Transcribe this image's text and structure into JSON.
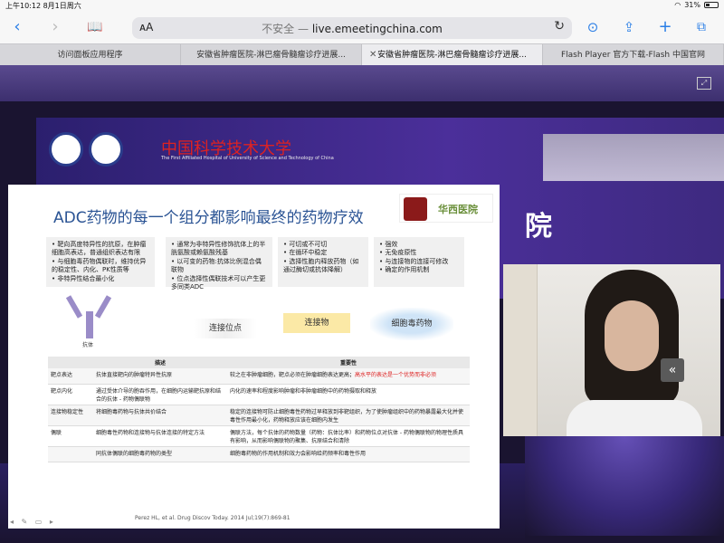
{
  "status_bar": {
    "time_date": "上午10:12  8月1日周六",
    "battery": "31%"
  },
  "toolbar": {
    "aa": "ᴀA",
    "insecure": "不安全 — ",
    "url": "live.emeetingchina.com"
  },
  "tabs": [
    {
      "label": "访问面板应用程序"
    },
    {
      "label": "安徽省肿瘤医院-淋巴瘤骨髓瘤诊疗进展..."
    },
    {
      "label": "安徽省肿瘤医院-淋巴瘤骨髓瘤诊疗进展..."
    },
    {
      "label": "Flash Player 官方下载-Flash 中国官网"
    }
  ],
  "hero": {
    "university": "中国科学技术大学",
    "university_sub": "The First Affiliated Hospital of University of Science and Technology of China",
    "big_char": "院"
  },
  "slide": {
    "title": "ADC药物的每一个组分都影响最终的药物疗效",
    "partner_logo": "华西医院",
    "box1": [
      "靶向高度特异性的抗原，在肿瘤细胞高表达，普通组织表达有限",
      "与细胞毒药物偶联时，维持优异的稳定性、内化、PK性质等",
      "非特异性结合最小化"
    ],
    "box2": [
      "通常为非特异性修饰抗体上的半胱氨酸或赖氨酸残基",
      "以可变的药物:抗体比例混合偶联物",
      "位点选择性偶联技术可以产生更多同类ADC"
    ],
    "box3": [
      "可切或不可切",
      "在循环中稳定",
      "选择性胞内释放药物（如通过酶切或抗体降解）"
    ],
    "box4": [
      "强效",
      "无免疫原性",
      "与连接物的连接可修改",
      "确定的作用机制"
    ],
    "antibody_label": "抗体",
    "link_position": "连接位点",
    "linker": "连接物",
    "payload": "细胞毒药物",
    "table_headers": [
      "",
      "描述",
      "重要性"
    ],
    "table_rows": [
      {
        "name": "靶点表达",
        "desc": "抗体直接靶向的肿瘤特异性抗原",
        "imp": "较之在非肿瘤细胞，靶点必须在肿瘤细胞表达更高；",
        "imp_red": "高水平的表达是一个优势而非必须"
      },
      {
        "name": "靶点内化",
        "desc": "通过受体介导的胞吞作用，在细胞内运输靶抗原和结合的抗体 - 药物偶联物",
        "imp": "内化的速率和程度影响肿瘤和非肿瘤细胞中的药物摄取和释放",
        "imp_red": ""
      },
      {
        "name": "连接物稳定性",
        "desc": "将细胞毒药物与抗体共价结合",
        "imp": "稳定的连接物可防止细胞毒性药物过早释放到非靶组织，为了使肿瘤组织中的药物暴露最大化并使毒性作用最小化，药物释放应该在细胞内发生",
        "imp_red": ""
      },
      {
        "name": "偶联",
        "desc": "细胞毒性药物和连接物与抗体连接的特定方法",
        "imp": "偶联方法，每个抗体的药物数量（药物：抗体比率）和药物位点对抗体 - 药物偶联物的物理性质具有影响，从而影响偶联物的聚集、抗原结合和清除",
        "imp_red": ""
      },
      {
        "name": "",
        "desc": "同抗体偶联的细胞毒药物的类型",
        "imp": "细胞毒药物的作用机制和效力会影响给药频率和毒性作用",
        "imp_red": ""
      }
    ],
    "citation": "Perez HL, et al. Drug Discov Today. 2014 Jul;19(7):869-81"
  }
}
